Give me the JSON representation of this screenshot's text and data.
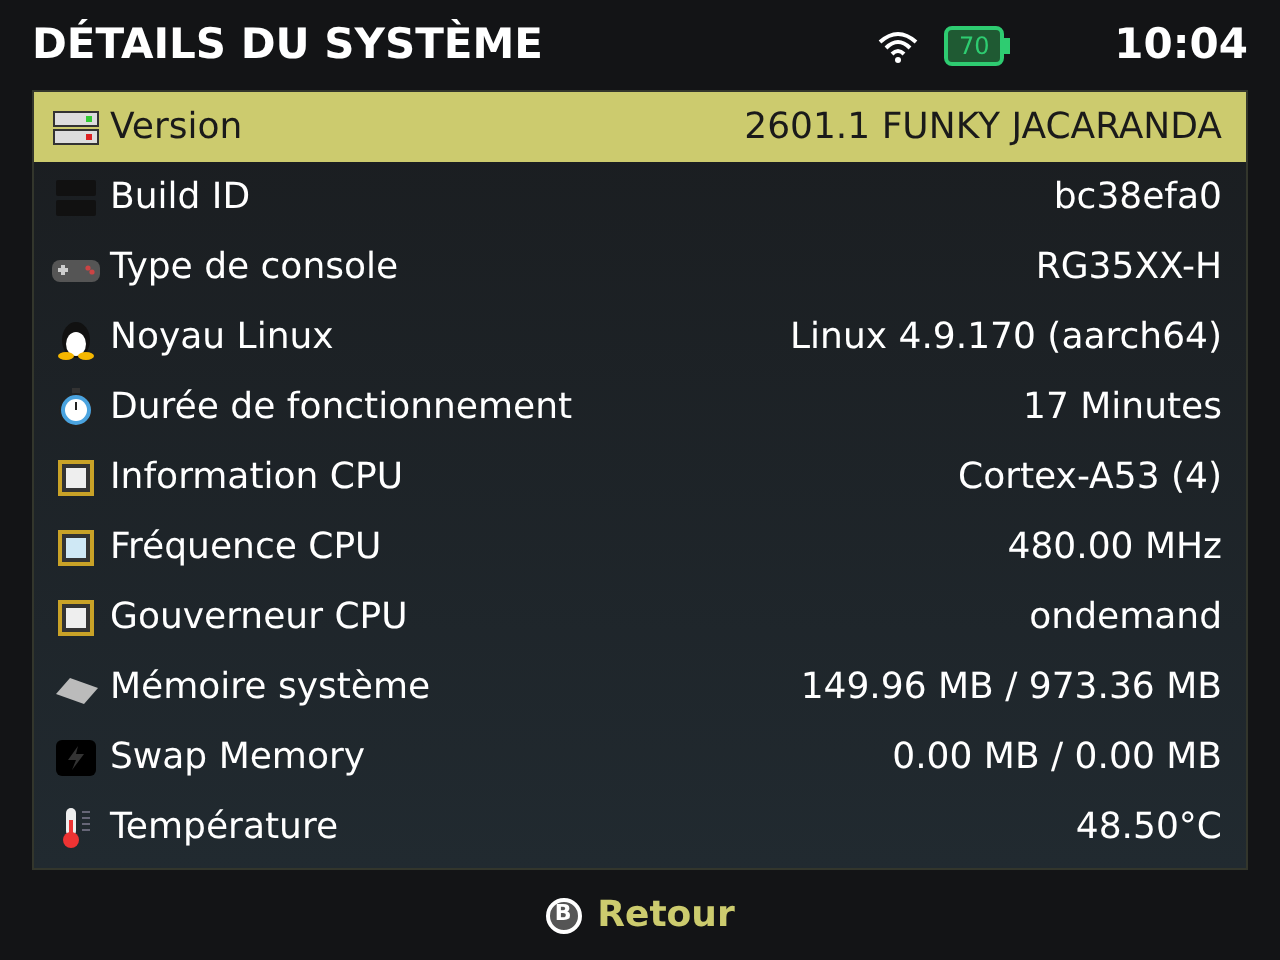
{
  "header": {
    "title": "DÉTAILS DU SYSTÈME",
    "battery": "70",
    "time": "10:04"
  },
  "rows": [
    {
      "kind": "server",
      "label": "Version",
      "value": "2601.1 FUNKY JACARANDA",
      "selected": true
    },
    {
      "kind": "drive",
      "label": "Build ID",
      "value": "bc38efa0",
      "selected": false
    },
    {
      "kind": "gamepad",
      "label": "Type de console",
      "value": "RG35XX-H",
      "selected": false
    },
    {
      "kind": "penguin",
      "label": "Noyau Linux",
      "value": "Linux 4.9.170 (aarch64)",
      "selected": false
    },
    {
      "kind": "stopwatch",
      "label": "Durée de fonctionnement",
      "value": "17 Minutes",
      "selected": false
    },
    {
      "kind": "chip",
      "label": "Information CPU",
      "value": "Cortex-A53 (4)",
      "selected": false
    },
    {
      "kind": "chipplain",
      "label": "Fréquence CPU",
      "value": "480.00 MHz",
      "selected": false
    },
    {
      "kind": "chip",
      "label": "Gouverneur CPU",
      "value": "ondemand",
      "selected": false
    },
    {
      "kind": "ram",
      "label": "Mémoire système",
      "value": "149.96 MB / 973.36 MB",
      "selected": false
    },
    {
      "kind": "swap",
      "label": "Swap Memory",
      "value": "0.00 MB / 0.00 MB",
      "selected": false
    },
    {
      "kind": "thermo",
      "label": "Température",
      "value": "48.50°C",
      "selected": false
    }
  ],
  "footer": {
    "button": "B",
    "label": "Retour"
  }
}
